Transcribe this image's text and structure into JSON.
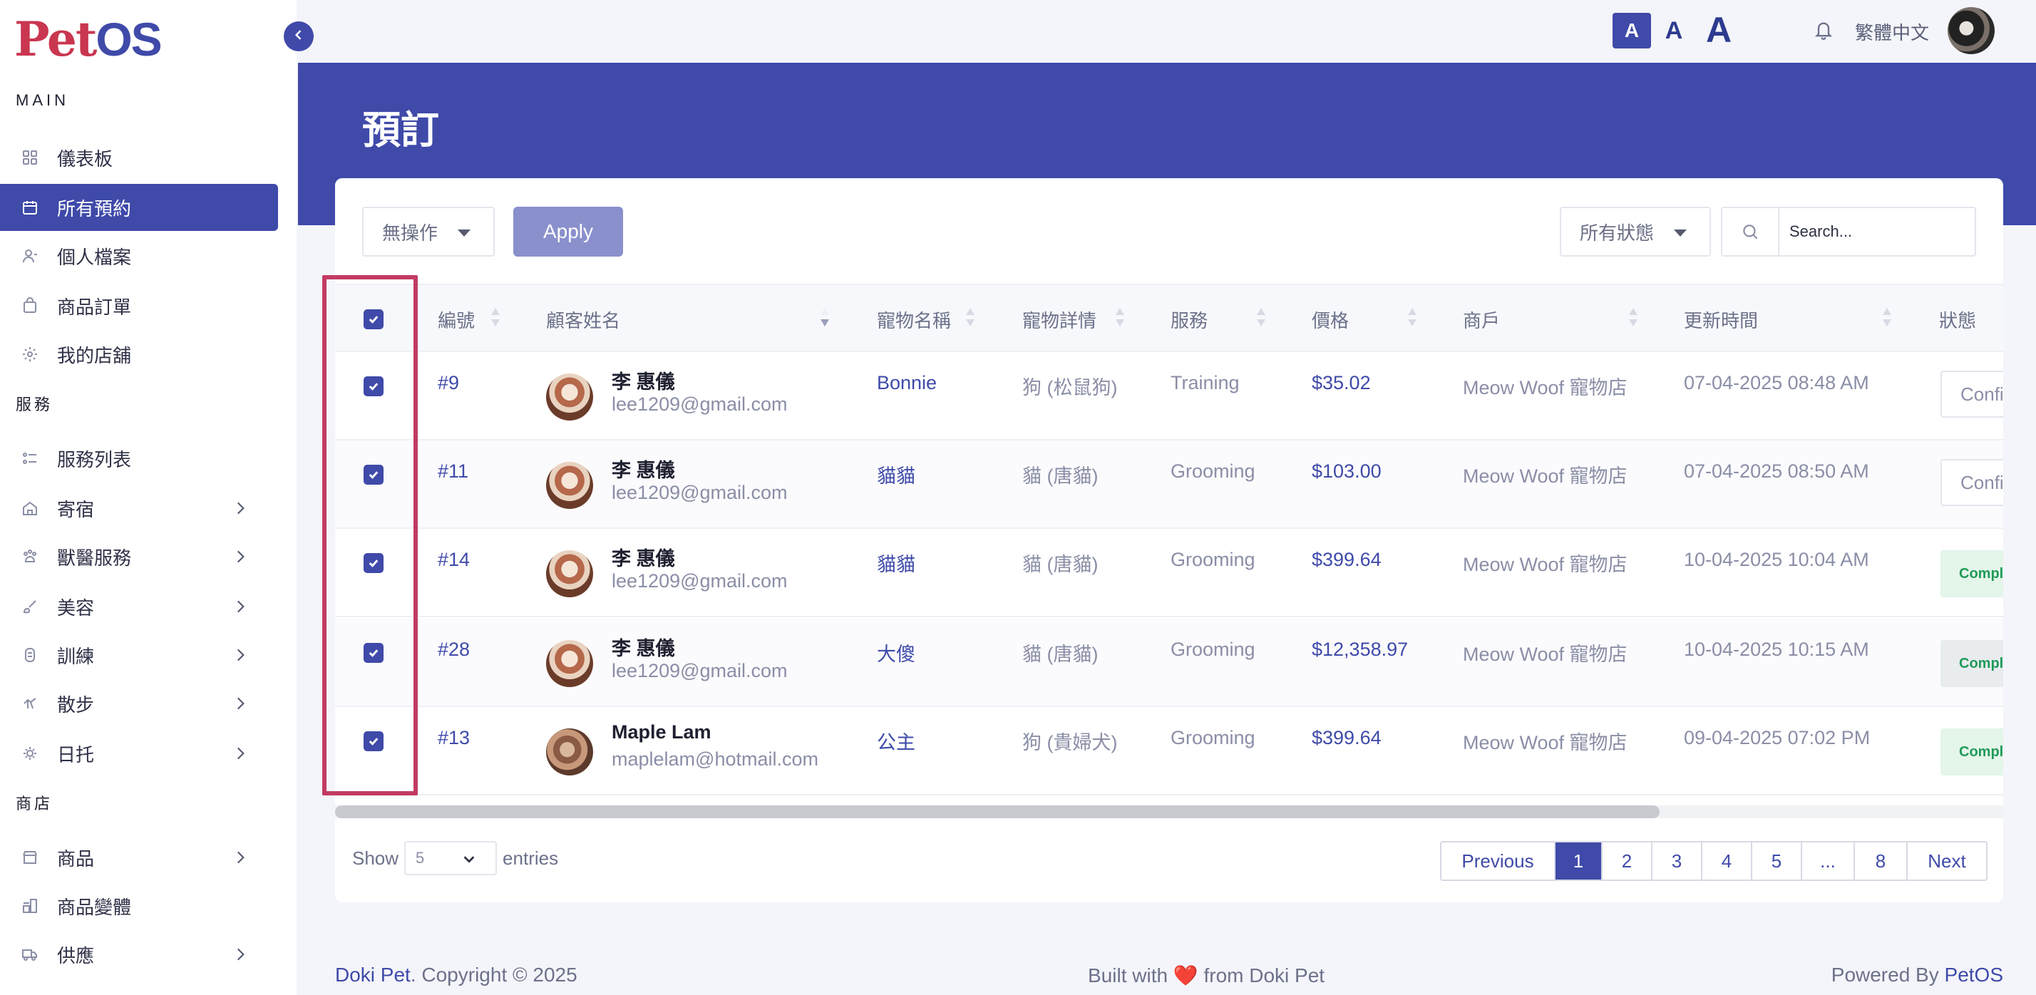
{
  "app": {
    "logo_pet": "Pet",
    "logo_os": "OS"
  },
  "sidebar": {
    "section_main": "MAIN",
    "section_service": "服務",
    "section_shop": "商店",
    "items": [
      {
        "label": "儀表板",
        "icon": "grid-icon"
      },
      {
        "label": "所有預約",
        "icon": "calendar-icon"
      },
      {
        "label": "個人檔案",
        "icon": "user-icon"
      },
      {
        "label": "商品訂單",
        "icon": "bag-icon"
      },
      {
        "label": "我的店舖",
        "icon": "store-gear-icon"
      },
      {
        "label": "服務列表",
        "icon": "list-icon"
      },
      {
        "label": "寄宿",
        "icon": "house-icon"
      },
      {
        "label": "獸醫服務",
        "icon": "vet-icon"
      },
      {
        "label": "美容",
        "icon": "brush-icon"
      },
      {
        "label": "訓練",
        "icon": "training-icon"
      },
      {
        "label": "散步",
        "icon": "walk-icon"
      },
      {
        "label": "日托",
        "icon": "daycare-icon"
      },
      {
        "label": "商品",
        "icon": "shop-icon"
      },
      {
        "label": "商品變體",
        "icon": "variants-icon"
      },
      {
        "label": "供應",
        "icon": "truck-icon"
      }
    ]
  },
  "topbar": {
    "font_small": "A",
    "font_medium": "A",
    "font_large": "A",
    "language": "繁體中文"
  },
  "page": {
    "title": "預訂"
  },
  "toolbar": {
    "bulk_action": "無操作",
    "apply_label": "Apply",
    "status_filter": "所有狀態",
    "search_placeholder": "Search..."
  },
  "table": {
    "headers": [
      "編號",
      "顧客姓名",
      "寵物名稱",
      "寵物詳情",
      "服務",
      "價格",
      "商戶",
      "更新時間",
      "狀態"
    ],
    "rows": [
      {
        "id": "#9",
        "name": "李 惠儀",
        "email": "lee1209@gmail.com",
        "pet": "Bonnie",
        "detail": "狗 (松鼠狗)",
        "service": "Training",
        "price": "$35.02",
        "merchant": "Meow Woof 寵物店",
        "updated": "07-04-2025 08:48 AM",
        "status": "Confirm"
      },
      {
        "id": "#11",
        "name": "李 惠儀",
        "email": "lee1209@gmail.com",
        "pet": "貓貓",
        "detail": "貓 (唐貓)",
        "service": "Grooming",
        "price": "$103.00",
        "merchant": "Meow Woof 寵物店",
        "updated": "07-04-2025 08:50 AM",
        "status": "Confirm"
      },
      {
        "id": "#14",
        "name": "李 惠儀",
        "email": "lee1209@gmail.com",
        "pet": "貓貓",
        "detail": "貓 (唐貓)",
        "service": "Grooming",
        "price": "$399.64",
        "merchant": "Meow Woof 寵物店",
        "updated": "10-04-2025 10:04 AM",
        "status": "Completed"
      },
      {
        "id": "#28",
        "name": "李 惠儀",
        "email": "lee1209@gmail.com",
        "pet": "大傻",
        "detail": "貓 (唐貓)",
        "service": "Grooming",
        "price": "$12,358.97",
        "merchant": "Meow Woof 寵物店",
        "updated": "10-04-2025 10:15 AM",
        "status": "Completed"
      },
      {
        "id": "#13",
        "name": "Maple Lam",
        "email": "maplelam@hotmail.com",
        "pet": "公主",
        "detail": "狗 (貴婦犬)",
        "service": "Grooming",
        "price": "$399.64",
        "merchant": "Meow Woof 寵物店",
        "updated": "09-04-2025 07:02 PM",
        "status": "Completed"
      }
    ]
  },
  "pagination": {
    "show_label": "Show",
    "entries_value": "5",
    "entries_label": "entries",
    "previous": "Previous",
    "pages": [
      "1",
      "2",
      "3",
      "4",
      "5",
      "...",
      "8"
    ],
    "next": "Next"
  },
  "footer": {
    "brand": "Doki Pet",
    "copyright": ". Copyright © 2025",
    "built_prefix": "Built with",
    "heart": "❤️",
    "built_suffix": "from Doki Pet",
    "powered_prefix": "Powered By",
    "powered_brand": "PetOS"
  },
  "colors": {
    "primary": "#3f4aa9",
    "accent_red": "#c23a62",
    "success": "#1f9a58"
  }
}
